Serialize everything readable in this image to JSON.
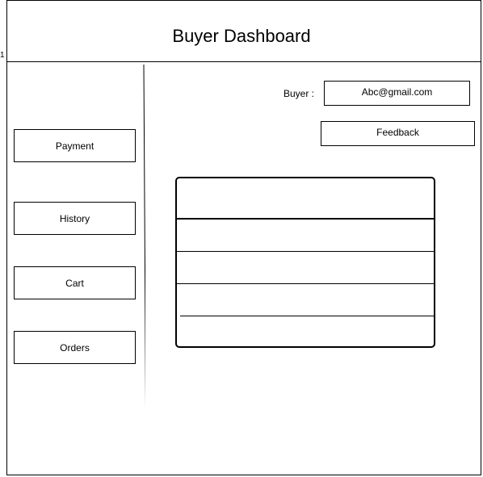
{
  "marker": "1",
  "header": {
    "title": "Buyer Dashboard"
  },
  "sidebar": {
    "items": [
      {
        "label": "Payment"
      },
      {
        "label": "History"
      },
      {
        "label": "Cart"
      },
      {
        "label": "Orders"
      }
    ]
  },
  "buyer": {
    "label": "Buyer :",
    "email": "Abc@gmail.com"
  },
  "actions": {
    "feedback_label": "Feedback"
  },
  "table": {
    "rows": [
      "",
      "",
      "",
      "",
      ""
    ]
  }
}
